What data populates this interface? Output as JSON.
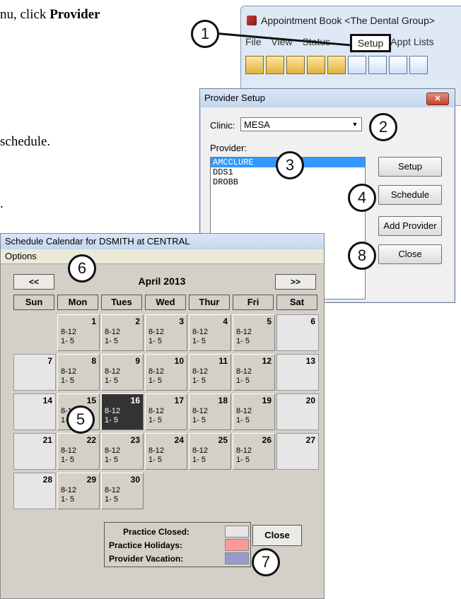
{
  "doc": {
    "line1_prefix": "nu, click ",
    "line1_bold": "Provider",
    "line2": "schedule.",
    "line3": "."
  },
  "appt_window": {
    "title": "Appointment Book <The Dental Group>",
    "menu": [
      "File",
      "View",
      "Status"
    ],
    "menu_setup": "Setup",
    "menu_after": "Appt Lists"
  },
  "provider_setup": {
    "title": "Provider Setup",
    "close_glyph": "✕",
    "clinic_label": "Clinic:",
    "clinic_value": "MESA",
    "provider_label": "Provider:",
    "providers": [
      "AMCCLURE",
      "DDS1",
      "DROBB"
    ],
    "buttons": {
      "setup": "Setup",
      "schedule": "Schedule",
      "add_provider": "Add Provider",
      "close": "Close"
    }
  },
  "calendar": {
    "title": "Schedule Calendar for DSMITH at CENTRAL",
    "menu_options": "Options",
    "prev": "<<",
    "next": ">>",
    "month": "April 2013",
    "days": [
      "Sun",
      "Mon",
      "Tues",
      "Wed",
      "Thur",
      "Fri",
      "Sat"
    ],
    "hours1": "8-12",
    "hours2": "1- 5",
    "weeks": [
      [
        null,
        1,
        2,
        3,
        4,
        5,
        6
      ],
      [
        7,
        8,
        9,
        10,
        11,
        12,
        13
      ],
      [
        14,
        15,
        16,
        17,
        18,
        19,
        20
      ],
      [
        21,
        22,
        23,
        24,
        25,
        26,
        27
      ],
      [
        28,
        29,
        30,
        null,
        null,
        null,
        null
      ]
    ],
    "selected_day": 16,
    "legend": {
      "closed": "Practice Closed:",
      "holidays": "Practice Holidays:",
      "vacation": "Provider Vacation:"
    },
    "legend_colors": {
      "closed": "#e6e6e6",
      "holidays": "#ff9999",
      "vacation": "#9999cc"
    },
    "close": "Close"
  },
  "badges": [
    "1",
    "2",
    "3",
    "4",
    "5",
    "6",
    "7",
    "8"
  ]
}
